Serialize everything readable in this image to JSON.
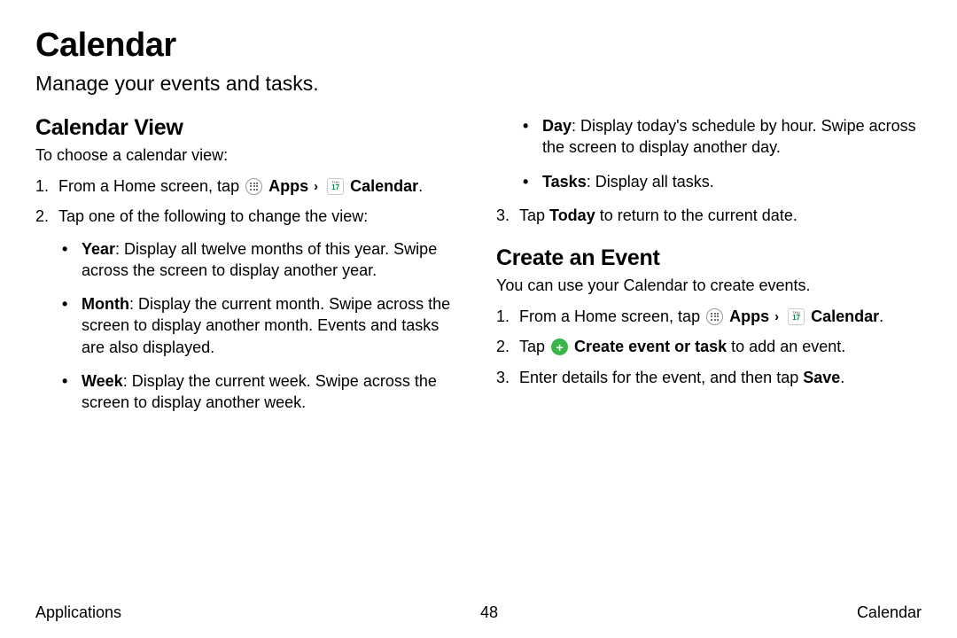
{
  "title": "Calendar",
  "subtitle": "Manage your events and tasks.",
  "left": {
    "heading": "Calendar View",
    "intro": "To choose a calendar view:",
    "step1_a": "From a Home screen, tap ",
    "apps_label": "Apps",
    "calendar_label": "Calendar",
    "period": ".",
    "step2": "Tap one of the following to change the view:",
    "bullets": {
      "year_label": "Year",
      "year_text": ": Display all twelve months of this year. Swipe across the screen to display another year.",
      "month_label": "Month",
      "month_text": ": Display the current month. Swipe across the screen to display another month. Events and tasks are also displayed.",
      "week_label": "Week",
      "week_text": ": Display the current week. Swipe across the screen to display another week."
    }
  },
  "right": {
    "bullets": {
      "day_label": "Day",
      "day_text": ": Display today's schedule by hour. Swipe across the screen to display another day.",
      "tasks_label": "Tasks",
      "tasks_text": ": Display all tasks."
    },
    "step3_a": "Tap ",
    "step3_bold": "Today",
    "step3_b": " to return to the current date.",
    "event_heading": "Create an Event",
    "event_intro": "You can use your Calendar to create events.",
    "ev_step1_a": "From a Home screen, tap ",
    "ev_step2_a": "Tap ",
    "ev_step2_bold": "Create event or task",
    "ev_step2_b": " to add an event.",
    "ev_step3_a": "Enter details for the event, and then tap ",
    "ev_step3_bold": "Save",
    "ev_step3_b": "."
  },
  "footer": {
    "left": "Applications",
    "center": "48",
    "right": "Calendar"
  },
  "icons": {
    "cal_day": "17",
    "cal_dow": "THU"
  }
}
